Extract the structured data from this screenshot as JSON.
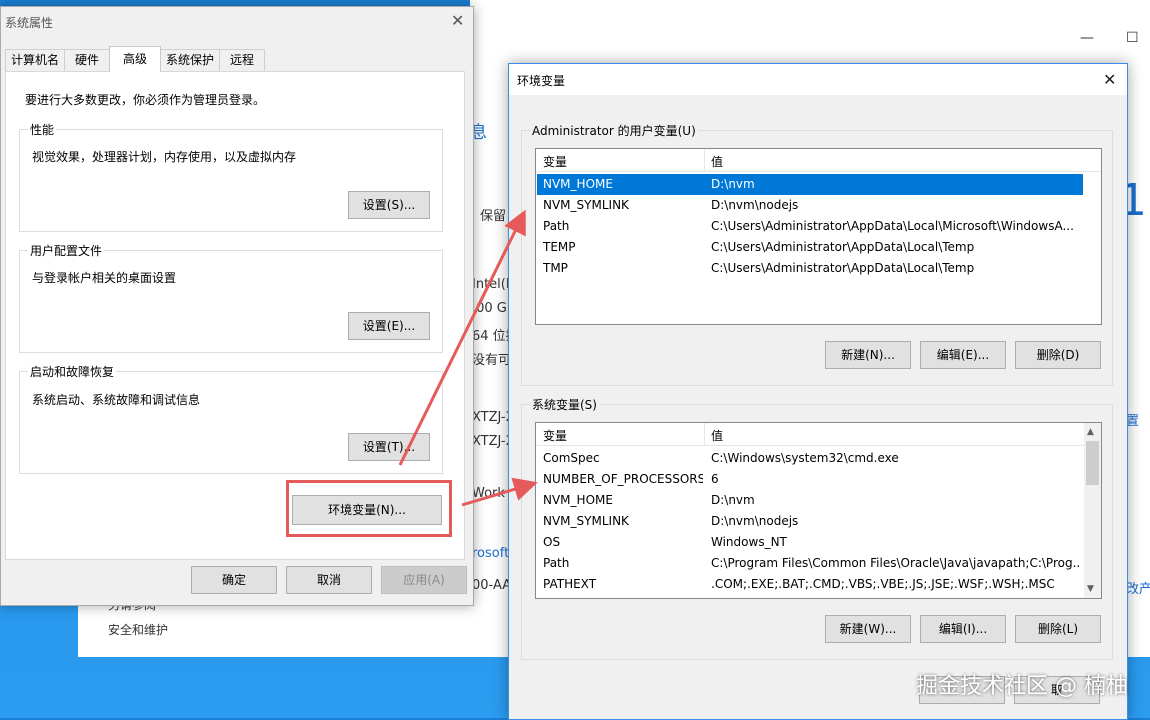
{
  "background_window": {
    "fragments": [
      "息",
      "保留",
      "Intel(R",
      ".00 G",
      "64 位操",
      "没有可",
      "XTZJ-2",
      "XTZJ-2",
      "Work",
      "rosoft",
      "00-AA",
      "置",
      "改产"
    ],
    "minimize": "—",
    "maximize": "☐",
    "left_items": [
      "另请参阅",
      "安全和维护"
    ]
  },
  "system_properties": {
    "title": "系统属性",
    "tabs": [
      "计算机名",
      "硬件",
      "高级",
      "系统保护",
      "远程"
    ],
    "active_tab": "高级",
    "admin_notice": "要进行大多数更改，你必须作为管理员登录。",
    "performance": {
      "legend": "性能",
      "desc": "视觉效果，处理器计划，内存使用，以及虚拟内存",
      "button": "设置(S)..."
    },
    "user_profiles": {
      "legend": "用户配置文件",
      "desc": "与登录帐户相关的桌面设置",
      "button": "设置(E)..."
    },
    "startup_recovery": {
      "legend": "启动和故障恢复",
      "desc": "系统启动、系统故障和调试信息",
      "button": "设置(T)..."
    },
    "env_button": "环境变量(N)...",
    "ok": "确定",
    "cancel": "取消",
    "apply": "应用(A)"
  },
  "env_vars": {
    "title": "环境变量",
    "user_section": {
      "legend": "Administrator 的用户变量(U)",
      "headers": [
        "变量",
        "值"
      ],
      "rows": [
        {
          "name": "NVM_HOME",
          "value": "D:\\nvm"
        },
        {
          "name": "NVM_SYMLINK",
          "value": "D:\\nvm\\nodejs"
        },
        {
          "name": "Path",
          "value": "C:\\Users\\Administrator\\AppData\\Local\\Microsoft\\WindowsA..."
        },
        {
          "name": "TEMP",
          "value": "C:\\Users\\Administrator\\AppData\\Local\\Temp"
        },
        {
          "name": "TMP",
          "value": "C:\\Users\\Administrator\\AppData\\Local\\Temp"
        }
      ],
      "selected": "NVM_HOME",
      "buttons": [
        "新建(N)...",
        "编辑(E)...",
        "删除(D)"
      ]
    },
    "system_section": {
      "legend": "系统变量(S)",
      "headers": [
        "变量",
        "值"
      ],
      "rows": [
        {
          "name": "ComSpec",
          "value": "C:\\Windows\\system32\\cmd.exe"
        },
        {
          "name": "NUMBER_OF_PROCESSORS",
          "value": "6"
        },
        {
          "name": "NVM_HOME",
          "value": "D:\\nvm"
        },
        {
          "name": "NVM_SYMLINK",
          "value": "D:\\nvm\\nodejs"
        },
        {
          "name": "OS",
          "value": "Windows_NT"
        },
        {
          "name": "Path",
          "value": "C:\\Program Files\\Common Files\\Oracle\\Java\\javapath;C:\\Prog..."
        },
        {
          "name": "PATHEXT",
          "value": ".COM;.EXE;.BAT;.CMD;.VBS;.VBE;.JS;.JSE;.WSF;.WSH;.MSC"
        }
      ],
      "buttons": [
        "新建(W)...",
        "编辑(I)...",
        "删除(L)"
      ]
    },
    "bottom_partial_button": "取",
    "close": "✕"
  },
  "watermark": "掘金技术社区 @ 楠柚",
  "colors": {
    "selection": "#0078d7",
    "annotation": "#e55a5a",
    "desktop": "#1e90e6"
  }
}
